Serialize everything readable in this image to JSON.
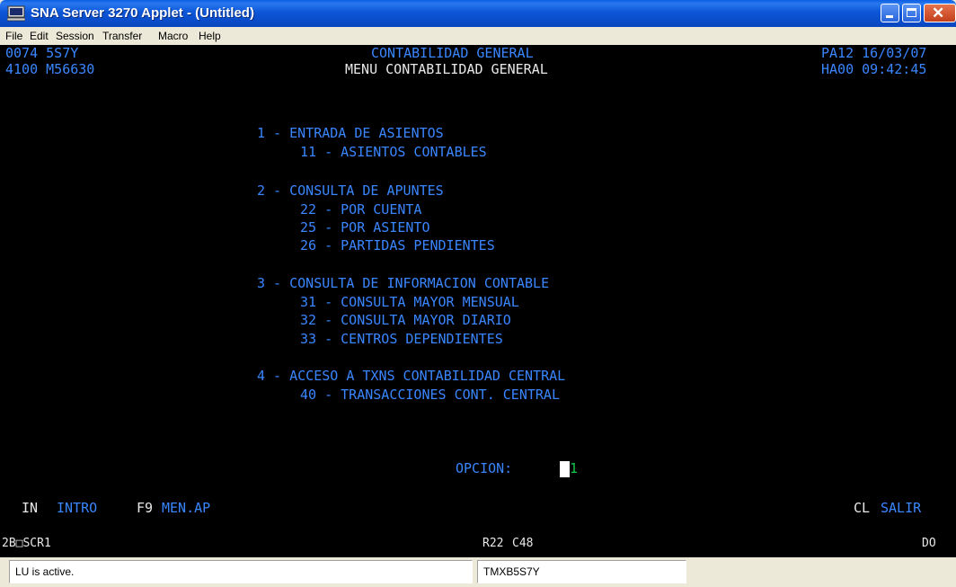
{
  "window": {
    "title": "SNA Server 3270 Applet  - (Untitled)"
  },
  "menu": [
    "File",
    "Edit",
    "Session",
    "Transfer",
    "Macro",
    "Help"
  ],
  "terminal": {
    "top_left_1": "0074 5S7Y",
    "top_left_2": "4100 M56630",
    "header_1": "CONTABILIDAD GENERAL",
    "header_2": "MENU CONTABILIDAD GENERAL",
    "top_right_1": "PA12 16/03/07",
    "top_right_2": "HA00 09:42:45",
    "menu_lines": [
      "1 - ENTRADA DE ASIENTOS",
      "11 - ASIENTOS CONTABLES",
      "2 - CONSULTA DE APUNTES",
      "22 - POR CUENTA",
      "25 - POR ASIENTO",
      "26 - PARTIDAS PENDIENTES",
      "3 - CONSULTA DE INFORMACION CONTABLE",
      "31 - CONSULTA MAYOR MENSUAL",
      "32 - CONSULTA MAYOR DIARIO",
      "33 - CENTROS DEPENDIENTES",
      "4 - ACCESO A TXNS CONTABILIDAD CENTRAL",
      "40 - TRANSACCIONES CONT. CENTRAL"
    ],
    "option_label": "OPCION:",
    "option_value": "1",
    "fkeys": {
      "in_key": "IN",
      "in_label": "INTRO",
      "f9_key": "F9",
      "f9_label": "MEN.AP",
      "cl_key": "CL",
      "cl_label": "SALIR"
    },
    "oia": {
      "left": "2B",
      "box": "□",
      "screen": "SCR1",
      "row": "R22",
      "col": "C48",
      "right": "DO"
    }
  },
  "status": {
    "message": "LU is active.",
    "lu_name": "TMXB5S7Y"
  },
  "colors": {
    "terminal_bg": "#000000",
    "field_blue": "#3a86ff",
    "field_white": "#e8e8e8",
    "input_green": "#17c44a"
  }
}
